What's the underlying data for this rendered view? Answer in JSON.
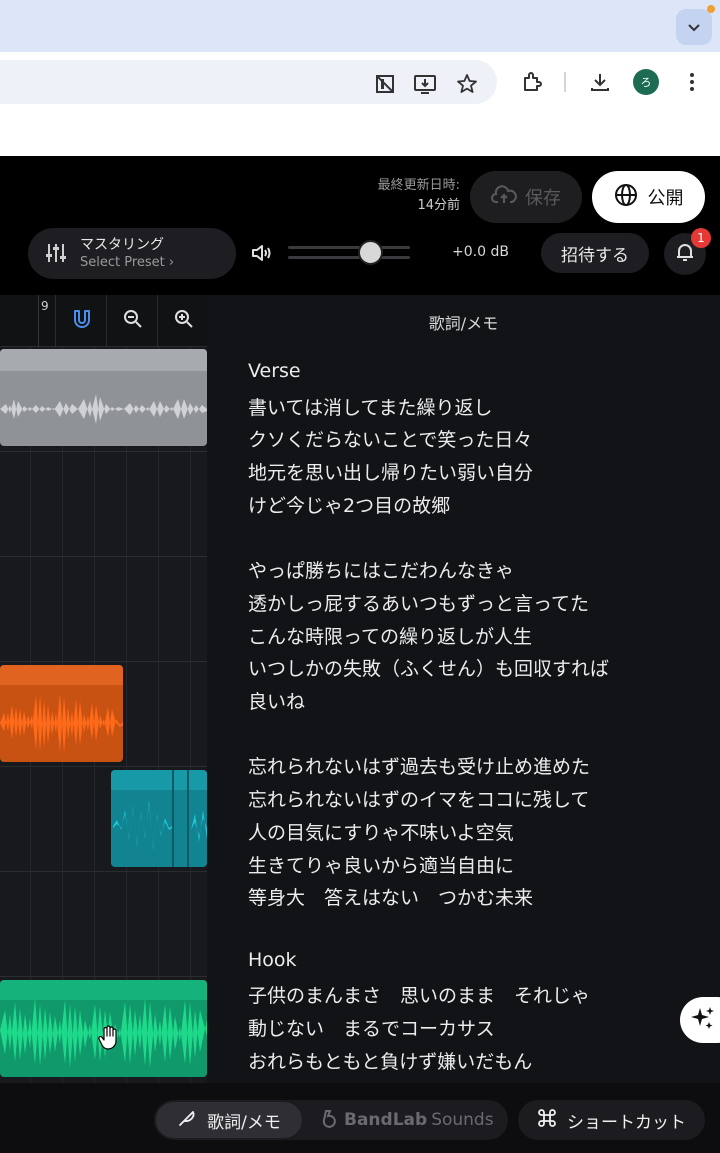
{
  "browser": {
    "avatar_letter": "ろ"
  },
  "header": {
    "last_updated_label": "最終更新日時:",
    "last_updated_value": "14分前",
    "save_label": "保存",
    "publish_label": "公開"
  },
  "mastering": {
    "title": "マスタリング",
    "subtitle": "Select Preset ›"
  },
  "volume": {
    "db": "+0.0 dB",
    "level": 0.68
  },
  "invite_label": "招待する",
  "notifications": {
    "count": "1"
  },
  "timeline": {
    "ruler_number": "9"
  },
  "lyrics": {
    "panel_title": "歌詞/メモ",
    "lines": [
      "Verse",
      "書いては消してまた繰り返し",
      "クソくだらないことで笑った日々",
      "地元を思い出し帰りたい弱い自分",
      "けど今じゃ2つ目の故郷",
      "",
      "やっぱ勝ちにはこだわんなきゃ",
      "透かしっ屁するあいつもずっと言ってた",
      "こんな時限っての繰り返しが人生",
      "いつしかの失敗（ふくせん）も回収すれば",
      "良いね",
      "",
      "忘れられないはず過去も受け止め進めた",
      "忘れられないはずのイマをココに残して",
      "人の目気にすりゃ不味いよ空気",
      "生きてりゃ良いから適当自由に",
      "等身大　答えはない　つかむ未来",
      "",
      "Hook",
      "子供のまんまさ　思いのまま　それじゃ",
      "動じない　まるでコーカサス",
      "おれらもともと負けず嫌いだもん"
    ]
  },
  "bottom": {
    "lyrics_tab": "歌詞/メモ",
    "sounds_brand": "BandLab",
    "sounds_word": "Sounds",
    "shortcut_label": "ショートカット"
  },
  "colors": {
    "orange_clip": "#ff6a1a",
    "cyan_clip": "#1ec8d8",
    "green_clip": "#1ed98a",
    "gray_clip": "#bfc2c6",
    "accent_blue": "#4a8ff0"
  }
}
